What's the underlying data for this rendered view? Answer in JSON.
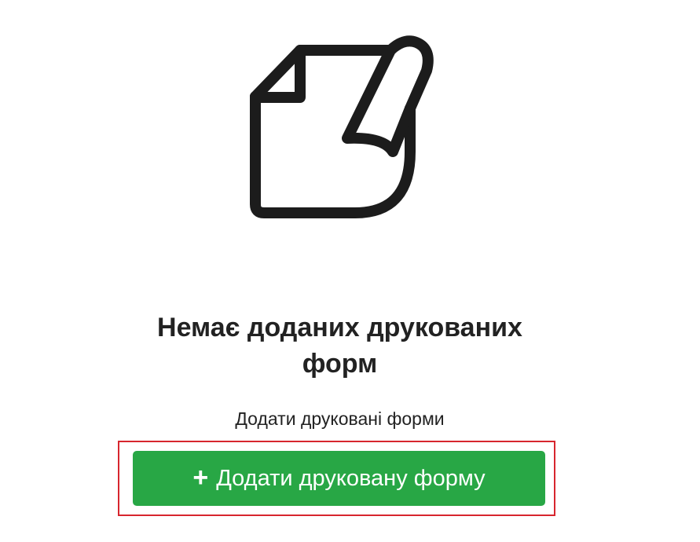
{
  "empty_state": {
    "icon": "document-curl-icon",
    "title": "Немає доданих друкованих форм",
    "subtitle": "Додати друковані форми",
    "button": {
      "icon": "+",
      "label": "Додати друковану форму"
    }
  },
  "colors": {
    "button_bg": "#28a745",
    "highlight_border": "#d7262e",
    "text": "#222222"
  }
}
